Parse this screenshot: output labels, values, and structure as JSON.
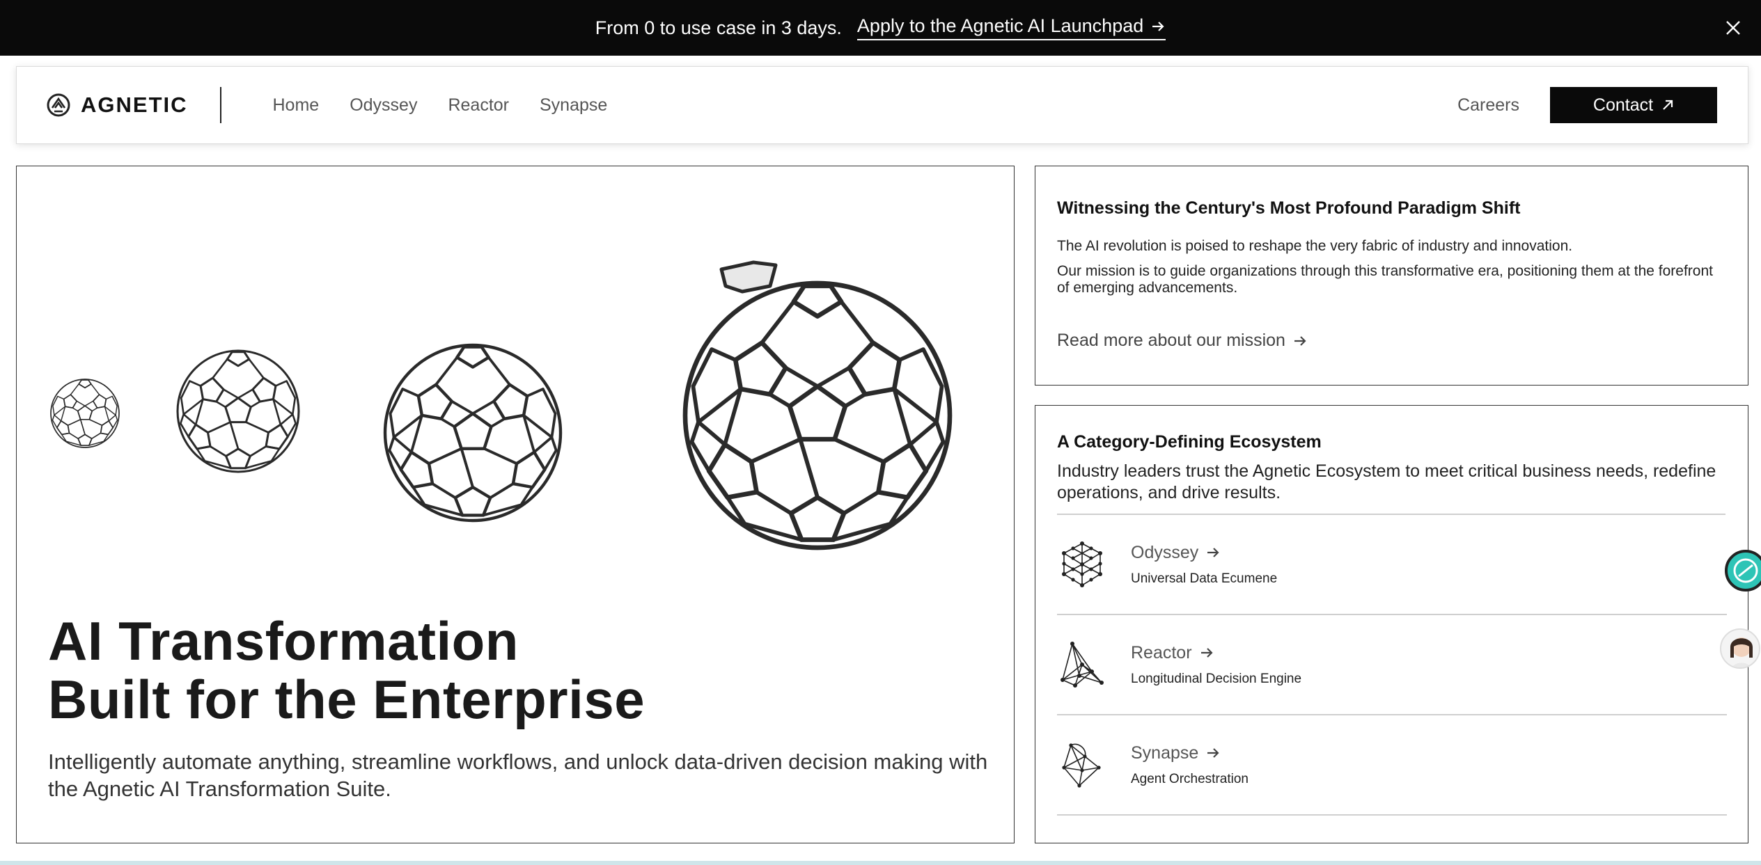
{
  "announcement": {
    "lead": "From 0 to use case in 3 days.",
    "cta": "Apply to the Agnetic AI Launchpad",
    "icons": {
      "arrow": "arrow-right-icon",
      "close": "close-icon"
    }
  },
  "nav": {
    "brand": "AGNETIC",
    "links": [
      "Home",
      "Odyssey",
      "Reactor",
      "Synapse"
    ],
    "careers": "Careers",
    "contact": "Contact",
    "icons": {
      "logo": "agnetic-logo-icon",
      "contact": "arrow-up-right-icon"
    }
  },
  "hero": {
    "title_line1": "AI Transformation",
    "title_line2": "Built for the Enterprise",
    "subtitle": "Intelligently automate anything, streamline workflows, and unlock data-driven decision making with the Agnetic AI Transformation Suite."
  },
  "mission": {
    "heading": "Witnessing the Century's Most Profound Paradigm Shift",
    "p1": "The AI revolution is poised to reshape the very fabric of industry and innovation.",
    "p2": "Our mission is to guide organizations through this transformative era, positioning them at the forefront of emerging advancements.",
    "link": "Read more about our mission"
  },
  "ecosystem": {
    "heading": "A Category-Defining Ecosystem",
    "description": "Industry leaders trust the Agnetic Ecosystem to meet critical business needs, redefine operations, and drive results.",
    "products": [
      {
        "name": "Odyssey",
        "subtitle": "Universal Data Ecumene",
        "icon": "odyssey-cube-icon"
      },
      {
        "name": "Reactor",
        "subtitle": "Longitudinal Decision Engine",
        "icon": "reactor-network-icon"
      },
      {
        "name": "Synapse",
        "subtitle": "Agent Orchestration",
        "icon": "synapse-polyhedron-icon"
      }
    ]
  },
  "colors": {
    "banner": "#0a0a0a",
    "contact_button": "#0a0a0a",
    "text": "#1a1a1a"
  }
}
